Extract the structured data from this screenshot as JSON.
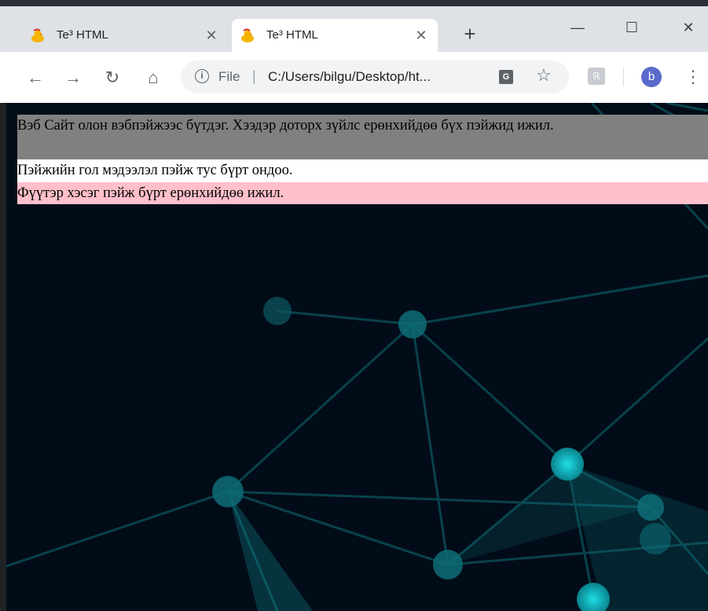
{
  "tabs": [
    {
      "title": "Te³ HTML",
      "active": false
    },
    {
      "title": "Te³ HTML",
      "active": true
    }
  ],
  "toolbar": {
    "scheme": "File",
    "url": "C:/Users/bilgu/Desktop/ht...",
    "avatar_letter": "b"
  },
  "page": {
    "header_text": "Вэб Сайт олон вэбпэйжээс бүтдэг. Хээдэр доторх зүйлс ерөнхийдөө бүх пэйжид ижил.",
    "main_text": "Пэйжийн гол мэдээлэл пэйж тус бүрт ондоо.",
    "footer_text": "Фүүтэр хэсэг пэйж бүрт ерөнхийдөө ижил."
  },
  "colors": {
    "header_bg": "#808080",
    "main_bg": "#ffffff",
    "footer_bg": "#ffc0cb",
    "page_bg": "#020c18",
    "network_accent": "#12b5c0"
  }
}
